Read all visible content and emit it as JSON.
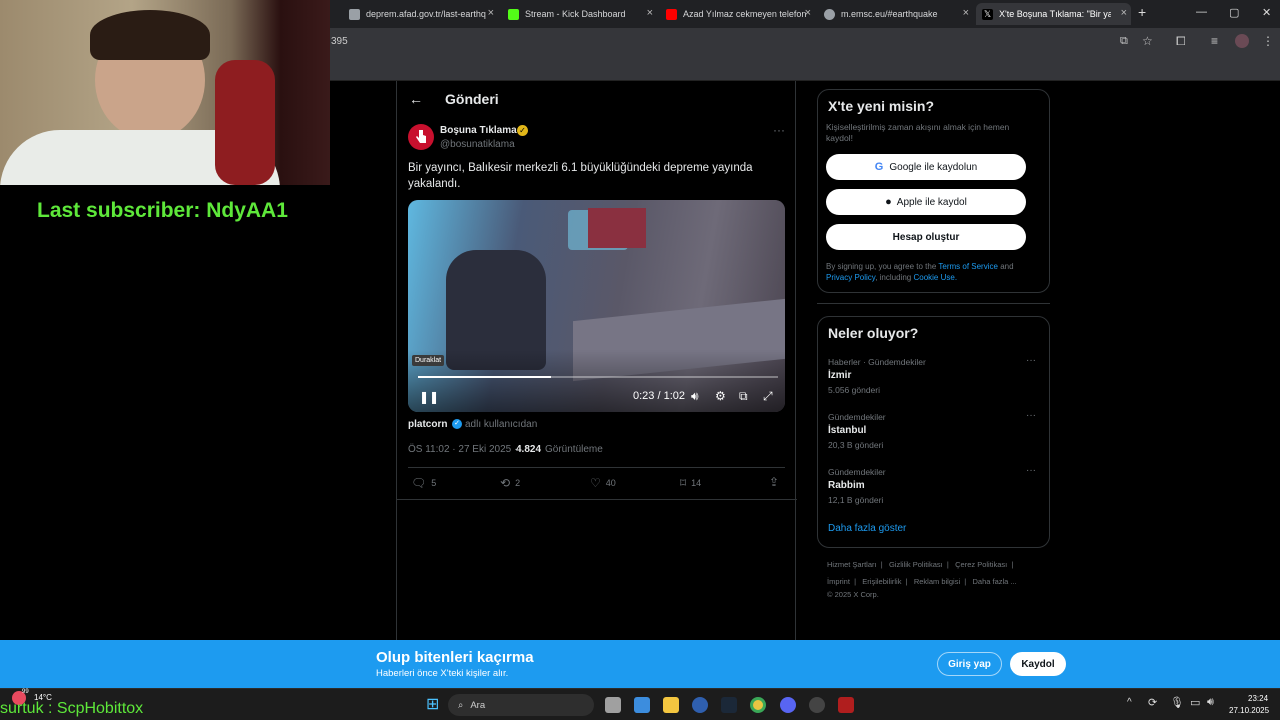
{
  "browser": {
    "tabs": [
      {
        "title": "deprem.afad.gov.tr/last-earthq",
        "color": "#9aa0a6"
      },
      {
        "title": "Stream - Kick Dashboard",
        "color": "#53fc18"
      },
      {
        "title": "Azad Yılmaz cekmeyen telefon",
        "color": "#ff0000"
      },
      {
        "title": "m.emsc.eu/#earthquake",
        "color": "#9aa0a6"
      },
      {
        "title": "X'te Boşuna Tıklama: \"Bir yay",
        "color": "#ffffff"
      }
    ],
    "url_fragment": "395"
  },
  "overlay": {
    "subscriber_text": "Last subscriber: NdyAA1",
    "bottom_name": "surtuk : ScpHobittox"
  },
  "post": {
    "header_title": "Gönderi",
    "author_name": "Boşuna Tıklama",
    "author_handle": "@bosunatiklama",
    "text": "Bir yayıncı, Balıkesir merkezli 6.1 büyüklüğündeki depreme yayında yakalandı.",
    "video": {
      "tooltip": "Duraklat",
      "time": "0:23 / 1:02",
      "progress": 0.37
    },
    "credit_name": "platcorn",
    "credit_suffix": "adlı kullanıcıdan",
    "meta_time": "ÖS 11:02 · 27 Eki 2025 ·",
    "views_count": "4.824",
    "views_label": "Görüntüleme",
    "actions": {
      "replies": "5",
      "reposts": "2",
      "likes": "40",
      "bookmarks": "14"
    }
  },
  "signup": {
    "title": "X'te yeni misin?",
    "subtitle": "Kişiselleştirilmiş zaman akışını almak için hemen kaydol!",
    "google": "Google ile kaydolun",
    "apple": "Apple ile kaydol",
    "create": "Hesap oluştur",
    "terms_pre": "By signing up, you agree to the",
    "terms_link": "Terms of Service",
    "terms_and": "and",
    "privacy_link": "Privacy Policy",
    "including": ", including",
    "cookie_link": "Cookie Use."
  },
  "trends": {
    "title": "Neler oluyor?",
    "items": [
      {
        "category": "Haberler · Gündemdekiler",
        "name": "İzmir",
        "count": "5.056 gönderi"
      },
      {
        "category": "Gündemdekiler",
        "name": "İstanbul",
        "count": "20,3 B gönderi"
      },
      {
        "category": "Gündemdekiler",
        "name": "Rabbim",
        "count": "12,1 B gönderi"
      }
    ],
    "show_more": "Daha fazla göster"
  },
  "footer": {
    "line1": [
      "Hizmet Şartları",
      "Gizlilik Politikası",
      "Çerez Politikası"
    ],
    "line2": [
      "İmprint",
      "Erişilebilirlik",
      "Reklam bilgisi",
      "Daha fazla ..."
    ],
    "copyright": "© 2025 X Corp."
  },
  "banner": {
    "title": "Olup bitenleri kaçırma",
    "subtitle": "Haberleri önce X'teki kişiler alır.",
    "login": "Giriş yap",
    "signup": "Kaydol"
  },
  "taskbar": {
    "weather_temp": "14°C",
    "search_placeholder": "Ara",
    "time": "23:24",
    "date": "27.10.2025",
    "notification_badge": "99"
  }
}
